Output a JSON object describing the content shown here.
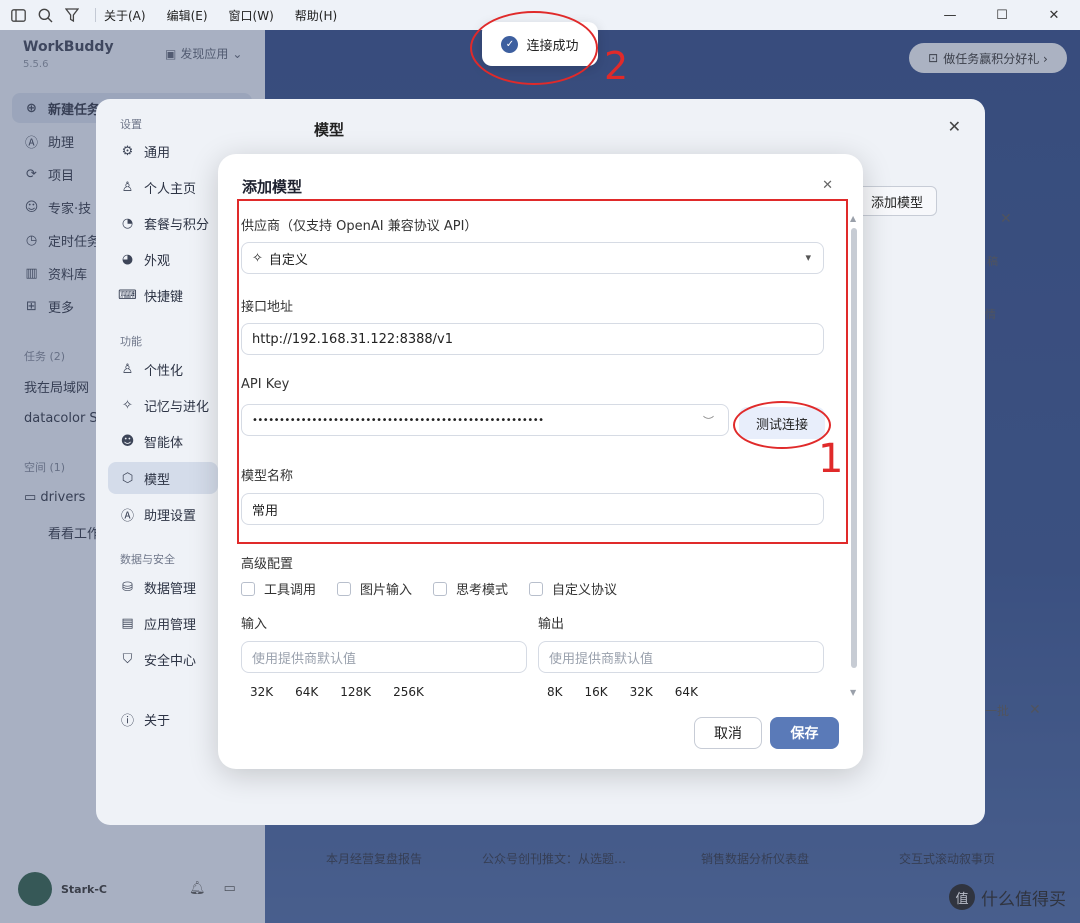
{
  "menubar": {
    "items": [
      "关于(A)",
      "编辑(E)",
      "窗口(W)",
      "帮助(H)"
    ],
    "window_controls": [
      "—",
      "☐",
      "✕"
    ]
  },
  "app": {
    "name": "WorkBuddy",
    "version": "5.5.6",
    "discover_label": "发现应用",
    "nav": [
      {
        "label": "新建任务",
        "icon": "plus-circle-icon"
      },
      {
        "label": "助理",
        "icon": "assistant-icon"
      },
      {
        "label": "项目",
        "icon": "project-icon"
      },
      {
        "label": "专家·技",
        "icon": "expert-icon"
      },
      {
        "label": "定时任务",
        "icon": "clock-icon"
      },
      {
        "label": "资料库",
        "icon": "book-icon"
      },
      {
        "label": "更多",
        "icon": "grid-icon"
      }
    ],
    "tasks_label": "任务 (2)",
    "tasks": [
      "我在局域网",
      "datacolor Sp"
    ],
    "space_label": "空间 (1)",
    "space_item": "drivers",
    "space_sub": "看看工作",
    "user_name": "Stark-C",
    "bonus_label": "做任务赢积分好礼 ›",
    "bottom_cards": [
      "本月经营复盘报告",
      "公众号创刊推文：从选题…",
      "销售数据分析仪表盘",
      "交互式滚动叙事页"
    ],
    "side_panel_text": [
      "稿",
      "情",
      "一批"
    ]
  },
  "settings": {
    "header_label": "设置",
    "title": "模型",
    "group_general": [
      {
        "label": "通用",
        "icon": "gear-icon"
      },
      {
        "label": "个人主页",
        "icon": "person-icon"
      },
      {
        "label": "套餐与积分",
        "icon": "pie-icon"
      },
      {
        "label": "外观",
        "icon": "palette-icon"
      },
      {
        "label": "快捷键",
        "icon": "keyboard-icon"
      }
    ],
    "group_func_label": "功能",
    "group_func": [
      {
        "label": "个性化",
        "icon": "person-cog-icon"
      },
      {
        "label": "记忆与进化",
        "icon": "bulb-icon"
      },
      {
        "label": "智能体",
        "icon": "robot-icon"
      },
      {
        "label": "模型",
        "icon": "cube-icon"
      },
      {
        "label": "助理设置",
        "icon": "assistant-icon"
      }
    ],
    "group_data_label": "数据与安全",
    "group_data": [
      {
        "label": "数据管理",
        "icon": "database-icon"
      },
      {
        "label": "应用管理",
        "icon": "app-icon"
      },
      {
        "label": "安全中心",
        "icon": "shield-icon"
      }
    ],
    "about": {
      "label": "关于",
      "icon": "info-icon"
    },
    "add_model_button": "添加模型"
  },
  "dialog": {
    "title": "添加模型",
    "provider_label": "供应商（仅支持 OpenAI 兼容协议 API）",
    "provider_value": "自定义",
    "endpoint_label": "接口地址",
    "endpoint_value": "http://192.168.31.122:8388/v1",
    "apikey_label": "API Key",
    "apikey_value": "••••••••••••••••••••••••••••••••••••••••••••••••••••••",
    "test_button": "测试连接",
    "model_name_label": "模型名称",
    "model_name_value": "常用",
    "advanced_label": "高级配置",
    "options": [
      "工具调用",
      "图片输入",
      "思考模式",
      "自定义协议"
    ],
    "input_label": "输入",
    "input_placeholder": "使用提供商默认值",
    "input_chips": [
      "32K",
      "64K",
      "128K",
      "256K"
    ],
    "output_label": "输出",
    "output_placeholder": "使用提供商默认值",
    "output_chips": [
      "8K",
      "16K",
      "32K",
      "64K"
    ],
    "cancel_button": "取消",
    "save_button": "保存"
  },
  "toast": {
    "text": "连接成功"
  },
  "annotations": {
    "one": "1",
    "two": "2"
  },
  "watermark": {
    "text": "什么值得买",
    "badge": "值"
  },
  "colors": {
    "accent": "#5a7ab8",
    "annotation": "#e02a2a",
    "toast_icon": "#3d5f9f"
  }
}
